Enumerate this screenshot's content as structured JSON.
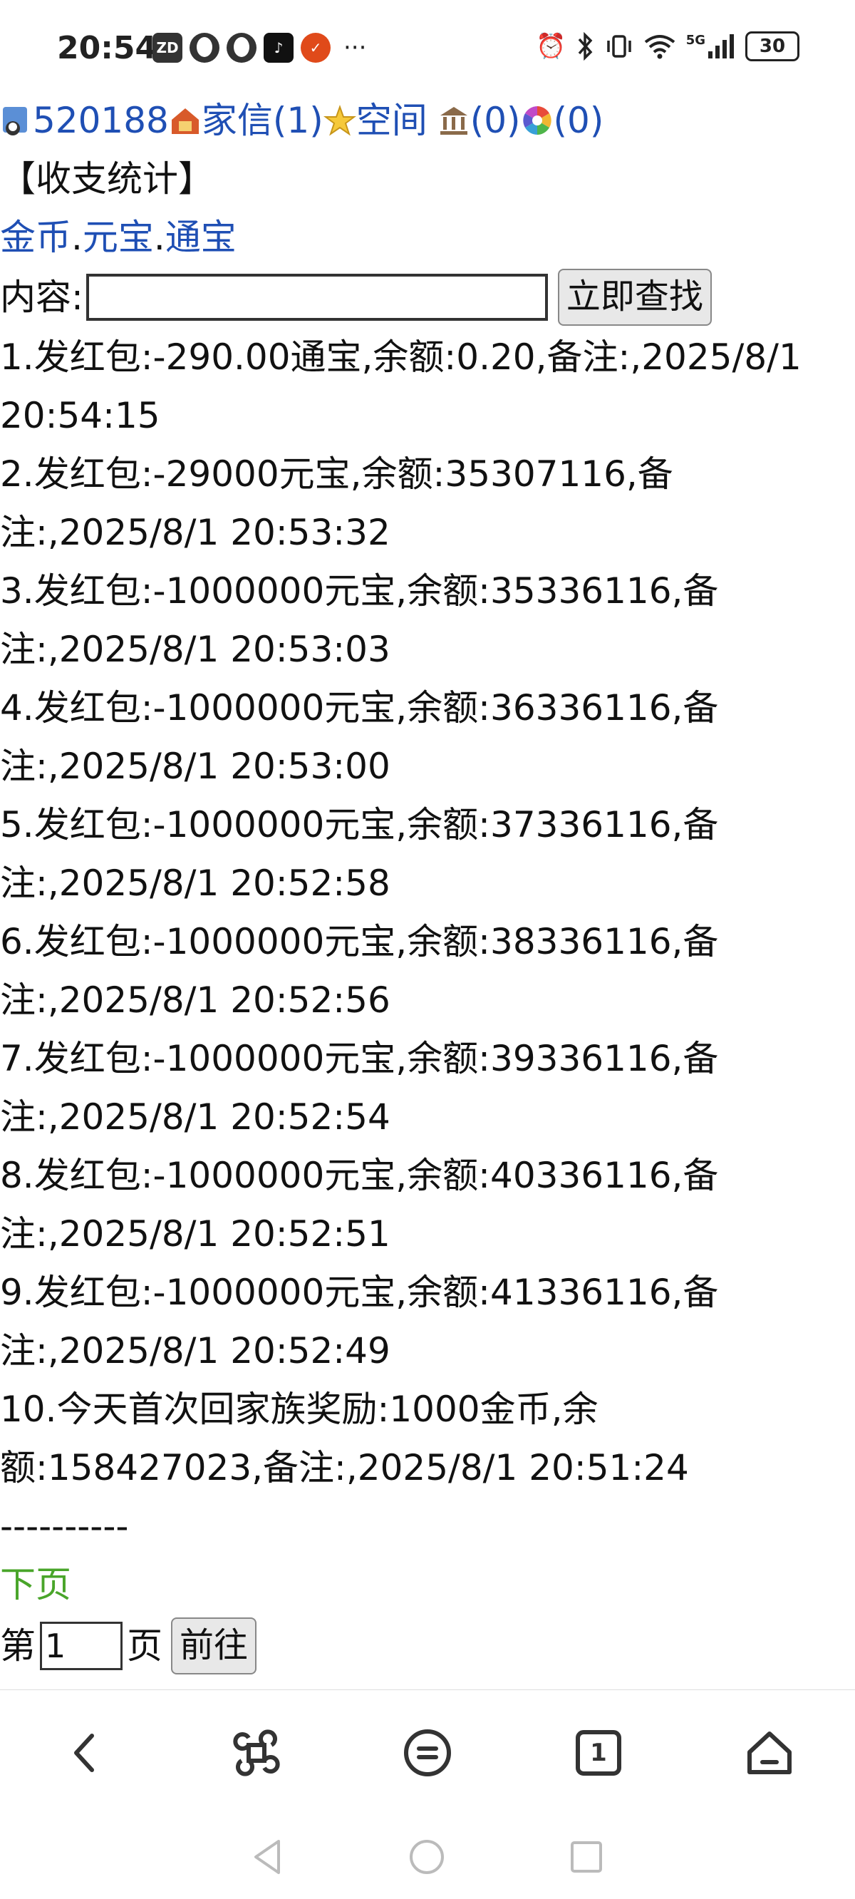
{
  "status_bar": {
    "time": "20:54",
    "left_icons": [
      "zd-app-icon",
      "qq-icon",
      "qq-icon",
      "tiktok-icon",
      "app-icon"
    ],
    "more": "···",
    "signal_text": "5G",
    "battery": "30"
  },
  "nav": {
    "user_id": "520188",
    "mail_label": "家信(1)",
    "space_label": "空间",
    "bank_count": "(0)",
    "color_count": "(0)"
  },
  "page_title": "【收支统计】",
  "currency_links": {
    "gold": "金币",
    "sep": ".",
    "ingot": "元宝",
    "token": "通宝"
  },
  "search": {
    "label": "内容:",
    "value": "",
    "button": "立即查找"
  },
  "records": [
    {
      "line1": "1.发红包:-290.00通宝,余额:0.20,备注:,2025/8/1",
      "line2": "20:54:15"
    },
    {
      "line1": "2.发红包:-29000元宝,余额:35307116,备",
      "line2": "注:,2025/8/1 20:53:32"
    },
    {
      "line1": "3.发红包:-1000000元宝,余额:35336116,备",
      "line2": "注:,2025/8/1 20:53:03"
    },
    {
      "line1": "4.发红包:-1000000元宝,余额:36336116,备",
      "line2": "注:,2025/8/1 20:53:00"
    },
    {
      "line1": "5.发红包:-1000000元宝,余额:37336116,备",
      "line2": "注:,2025/8/1 20:52:58"
    },
    {
      "line1": "6.发红包:-1000000元宝,余额:38336116,备",
      "line2": "注:,2025/8/1 20:52:56"
    },
    {
      "line1": "7.发红包:-1000000元宝,余额:39336116,备",
      "line2": "注:,2025/8/1 20:52:54"
    },
    {
      "line1": "8.发红包:-1000000元宝,余额:40336116,备",
      "line2": "注:,2025/8/1 20:52:51"
    },
    {
      "line1": "9.发红包:-1000000元宝,余额:41336116,备",
      "line2": "注:,2025/8/1 20:52:49"
    },
    {
      "line1": "10.今天首次回家族奖励:1000金币,余",
      "line2": "额:158427023,备注:,2025/8/1 20:51:24"
    }
  ],
  "divider": "----------",
  "pagination": {
    "next": "下页",
    "prefix": "第",
    "page_value": "1",
    "suffix": "页",
    "go_button": "前往"
  },
  "toolbar": {
    "back": "back-icon",
    "menu": "command-icon",
    "list": "list-icon",
    "tabs": "1",
    "home": "home-icon"
  },
  "system_nav": [
    "back-triangle-icon",
    "home-circle-icon",
    "recents-square-icon"
  ]
}
